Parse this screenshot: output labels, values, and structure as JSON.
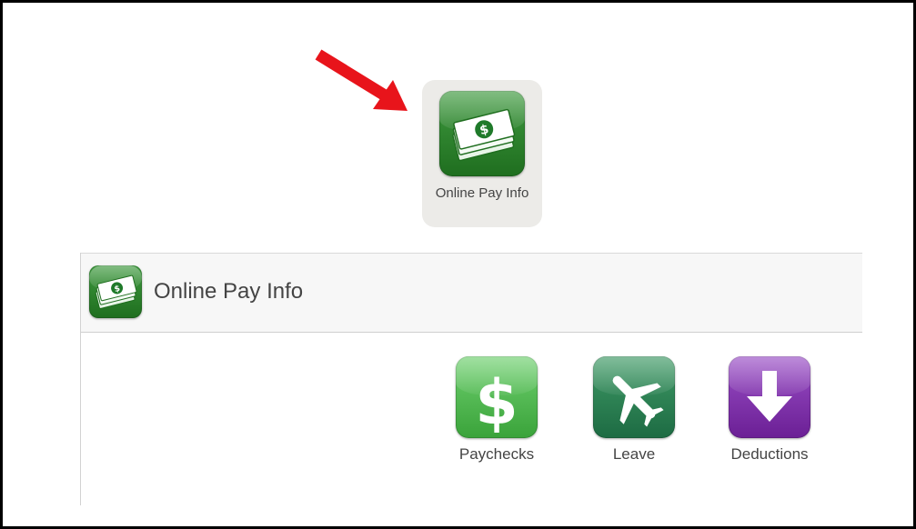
{
  "top_tile": {
    "label": "Online Pay Info",
    "icon": "money-icon"
  },
  "panel": {
    "title": "Online Pay Info",
    "icon": "money-icon",
    "apps": [
      {
        "label": "Paychecks",
        "icon": "dollar-sign-icon",
        "color": "#4cb84c"
      },
      {
        "label": "Leave",
        "icon": "airplane-icon",
        "color": "#2e8553"
      },
      {
        "label": "Deductions",
        "icon": "arrow-down-icon",
        "color": "#7f35ad"
      }
    ]
  },
  "colors": {
    "arrow": "#e8141b",
    "tile_bg": "#ecebe8",
    "header_bg": "#f7f7f7"
  }
}
